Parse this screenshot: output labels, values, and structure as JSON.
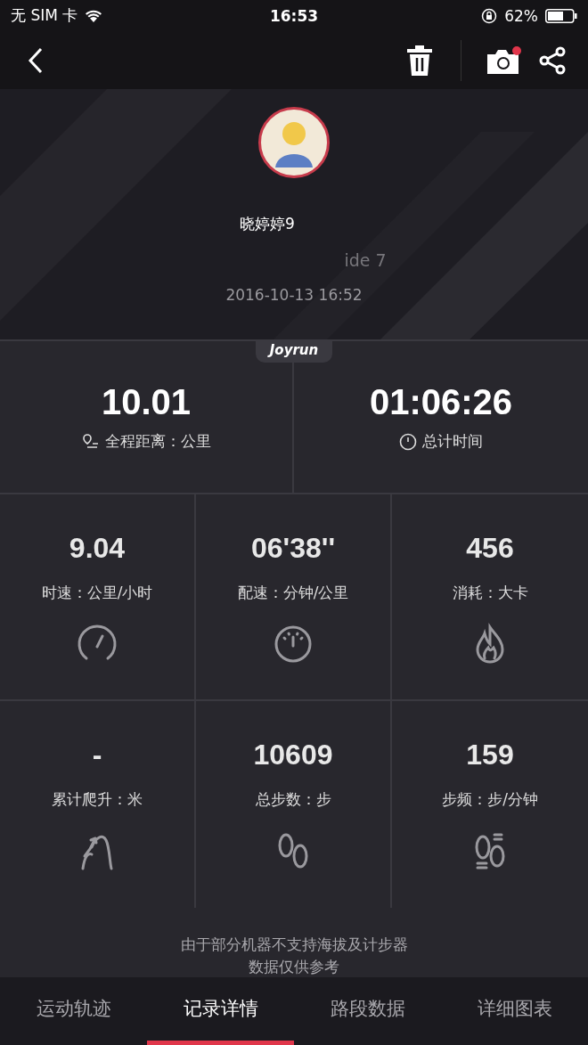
{
  "status_bar": {
    "carrier": "无 SIM 卡",
    "time": "16:53",
    "battery": "62%"
  },
  "profile": {
    "name": "晓婷婷9",
    "device": "ide 7",
    "date": "2016-10-13 16:52",
    "brand": "Joyrun"
  },
  "summary": [
    {
      "value": "10.01",
      "label": "全程距离：公里",
      "kind": "route"
    },
    {
      "value": "01:06:26",
      "label": "总计时间",
      "kind": "timer"
    }
  ],
  "metrics": [
    {
      "value": "9.04",
      "label": "时速：公里/小时",
      "kind": "speedometer"
    },
    {
      "value": "06'38''",
      "label": "配速：分钟/公里",
      "kind": "gauge"
    },
    {
      "value": "456",
      "label": "消耗：大卡",
      "kind": "flame"
    },
    {
      "value": "-",
      "label": "累计爬升：米",
      "kind": "climb"
    },
    {
      "value": "10609",
      "label": "总步数：步",
      "kind": "footprints"
    },
    {
      "value": "159",
      "label": "步频：步/分钟",
      "kind": "cadence"
    }
  ],
  "note": [
    "由于部分机器不支持海拔及计步器",
    "数据仅供参考"
  ],
  "tabs": [
    {
      "label": "运动轨迹",
      "selected": false
    },
    {
      "label": "记录详情",
      "selected": true
    },
    {
      "label": "路段数据",
      "selected": false
    },
    {
      "label": "详细图表",
      "selected": false
    }
  ]
}
